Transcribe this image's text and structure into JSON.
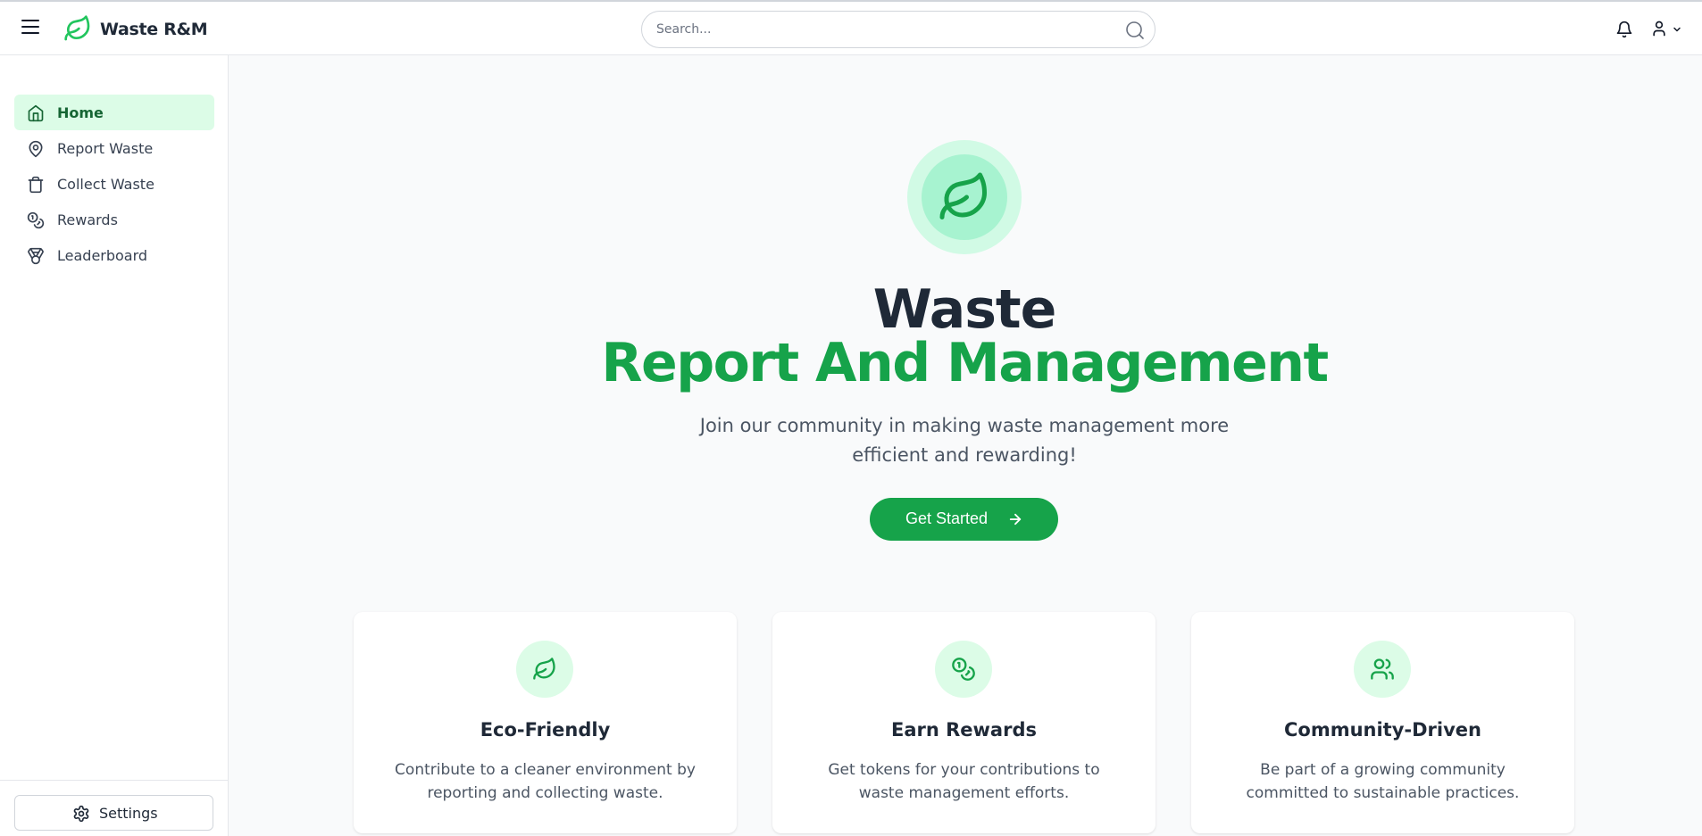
{
  "header": {
    "brand": "Waste R&M",
    "search_placeholder": "Search..."
  },
  "sidebar": {
    "items": [
      {
        "label": "Home",
        "icon": "home-icon",
        "active": true
      },
      {
        "label": "Report Waste",
        "icon": "map-pin-icon",
        "active": false
      },
      {
        "label": "Collect Waste",
        "icon": "trash-icon",
        "active": false
      },
      {
        "label": "Rewards",
        "icon": "coins-icon",
        "active": false
      },
      {
        "label": "Leaderboard",
        "icon": "medal-icon",
        "active": false
      }
    ],
    "settings_label": "Settings"
  },
  "hero": {
    "title": "Waste",
    "subtitle": "Report And Management",
    "description": "Join our community in making waste management more efficient and rewarding!",
    "cta_label": "Get Started"
  },
  "features": [
    {
      "title": "Eco-Friendly",
      "description": "Contribute to a cleaner environment by reporting and collecting waste.",
      "icon": "leaf-icon"
    },
    {
      "title": "Earn Rewards",
      "description": "Get tokens for your contributions to waste management efforts.",
      "icon": "coins-icon"
    },
    {
      "title": "Community-Driven",
      "description": "Be part of a growing community committed to sustainable practices.",
      "icon": "users-icon"
    }
  ],
  "colors": {
    "accent": "#16a34a",
    "accent_light": "#dcfce7",
    "text_dark": "#1f2937"
  }
}
